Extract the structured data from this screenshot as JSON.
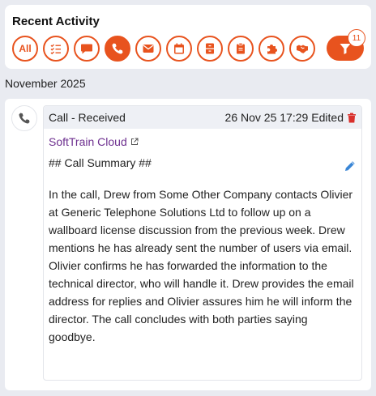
{
  "header": {
    "title": "Recent Activity",
    "filters": [
      {
        "label": "All",
        "icon": "all-label",
        "active": false
      },
      {
        "label": "",
        "icon": "checklist-icon",
        "active": false
      },
      {
        "label": "",
        "icon": "chat-icon",
        "active": false
      },
      {
        "label": "",
        "icon": "phone-icon",
        "active": true
      },
      {
        "label": "",
        "icon": "envelope-icon",
        "active": false
      },
      {
        "label": "",
        "icon": "calendar-icon",
        "active": false
      },
      {
        "label": "",
        "icon": "file-cabinet-icon",
        "active": false
      },
      {
        "label": "",
        "icon": "clipboard-icon",
        "active": false
      },
      {
        "label": "",
        "icon": "puzzle-icon",
        "active": false
      },
      {
        "label": "",
        "icon": "handshake-icon",
        "active": false
      }
    ],
    "filter_count": "11",
    "accent_color": "#e8531e"
  },
  "month_label": "November 2025",
  "activity": {
    "type": "Call - Received",
    "datetime": "26 Nov 25 17:29",
    "edited": "Edited",
    "link_text": "SoftTrain Cloud",
    "summary_heading": "## Call Summary ##",
    "summary_text": "In the call, Drew from Some Other Company contacts Olivier at Generic Telephone Solutions Ltd to follow up on a wallboard license discussion from the previous week. Drew mentions he has already sent the number of users via email. Olivier confirms he has forwarded the information to the technical director, who will handle it. Drew provides the email address for replies and Olivier assures him he will inform the director. The call concludes with both parties saying goodbye."
  }
}
